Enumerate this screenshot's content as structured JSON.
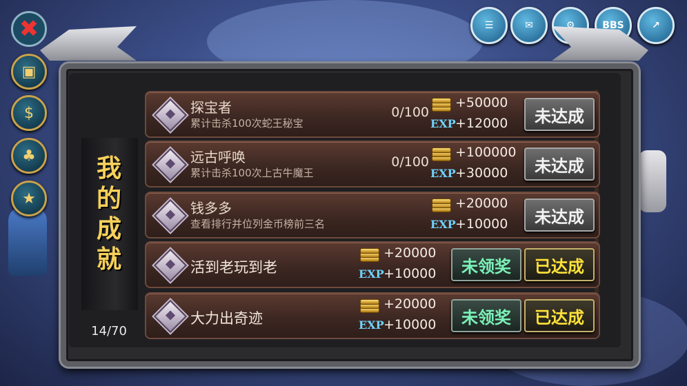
{
  "panel": {
    "title": "我的成就",
    "count": "14/70"
  },
  "achievements": [
    {
      "name": "探宝者",
      "desc": "累计击杀100次蛇王秘宝",
      "progress": "0/100",
      "gold": "+50000",
      "exp_label": "EXP",
      "exp": "+12000",
      "status": "未达成"
    },
    {
      "name": "远古呼唤",
      "desc": "累计击杀100次上古牛魔王",
      "progress": "0/100",
      "gold": "+100000",
      "exp_label": "EXP",
      "exp": "+30000",
      "status": "未达成"
    },
    {
      "name": "钱多多",
      "desc": "查看排行并位列金币榜前三名",
      "progress": "",
      "gold": "+20000",
      "exp_label": "EXP",
      "exp": "+10000",
      "status": "未达成"
    },
    {
      "name": "活到老玩到老",
      "gold": "+20000",
      "exp_label": "EXP",
      "exp": "+10000",
      "claim": "未领奖",
      "status": "已达成"
    },
    {
      "name": "大力出奇迹",
      "gold": "+20000",
      "exp_label": "EXP",
      "exp": "+10000",
      "claim": "未领奖",
      "status": "已达成"
    }
  ],
  "top_buttons": [
    {
      "icon": "profile-list-icon"
    },
    {
      "icon": "chat-icon"
    },
    {
      "icon": "settings-icon"
    },
    {
      "icon": "bbs-icon",
      "label": "BBS"
    },
    {
      "icon": "share-icon"
    }
  ],
  "side_buttons": [
    {
      "icon": "close-icon",
      "label": "✖"
    },
    {
      "icon": "treasure-chest-icon",
      "label": "▣"
    },
    {
      "icon": "coin-icon",
      "label": "$"
    },
    {
      "icon": "club-icon",
      "label": "♣"
    },
    {
      "icon": "star-icon",
      "label": "★"
    }
  ]
}
